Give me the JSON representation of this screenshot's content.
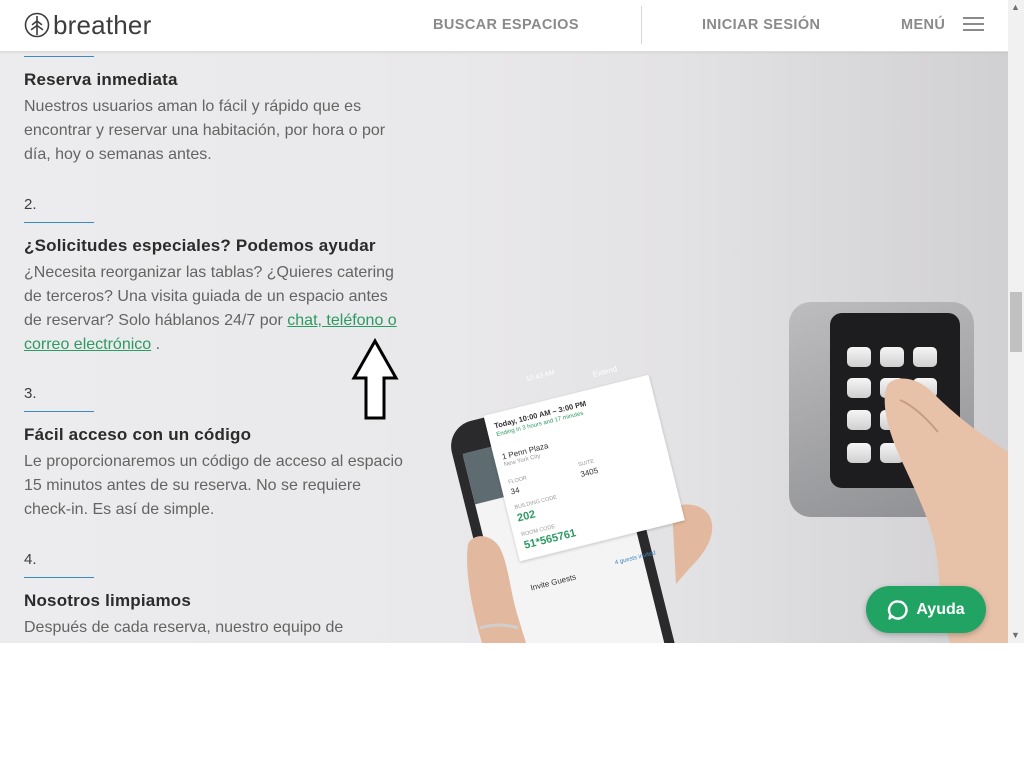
{
  "header": {
    "logo_text": "breather",
    "nav": {
      "search_label": "BUSCAR ESPACIOS",
      "login_label": "INICIAR SESIÓN",
      "menu_label": "MENÚ"
    }
  },
  "steps": [
    {
      "title": "Reserva inmediata",
      "text": "Nuestros usuarios aman lo fácil y rápido que es encontrar y reservar una habitación, por hora o por día, hoy o semanas antes."
    },
    {
      "number": "2.",
      "title": "¿Solicitudes especiales? Podemos ayudar",
      "text_before_link": "¿Necesita reorganizar las tablas? ¿Quieres catering de terceros? Una visita guiada de un espacio antes de reservar? Solo háblanos 24/7 por ",
      "link_text": "chat, teléfono o correo electrónico",
      "text_after_link": " ."
    },
    {
      "number": "3.",
      "title": "Fácil acceso con un código",
      "text": "Le proporcionaremos un código de acceso al espacio 15 minutos antes de su reserva. No se requiere check-in. Es así de simple."
    },
    {
      "number": "4.",
      "title": "Nosotros limpiamos",
      "text": "Después de cada reserva, nuestro equipo de"
    }
  ],
  "phone_screen": {
    "status_time": "10:43 AM",
    "extend_label": "Extend",
    "booking_time": "Today, 10:00 AM – 3:00 PM",
    "booking_ending": "Ending in 3 hours and 17 minutes",
    "address": "1 Penn Plaza",
    "city": "New York City",
    "floor_label": "FLOOR",
    "floor_value": "34",
    "suite_label": "SUITE",
    "suite_value": "3405",
    "building_code_label": "BUILDING CODE",
    "building_code_value": "202",
    "room_code_label": "ROOM CODE",
    "room_code_value": "51*565761",
    "invite_label": "Invite Guests",
    "guests_invited": "4 guests invited"
  },
  "help_button": {
    "label": "Ayuda"
  },
  "colors": {
    "accent_green": "#20a363",
    "link_green": "#2d9a63",
    "rule_blue": "#3b8ac4",
    "nav_gray": "#8a8a8a"
  }
}
